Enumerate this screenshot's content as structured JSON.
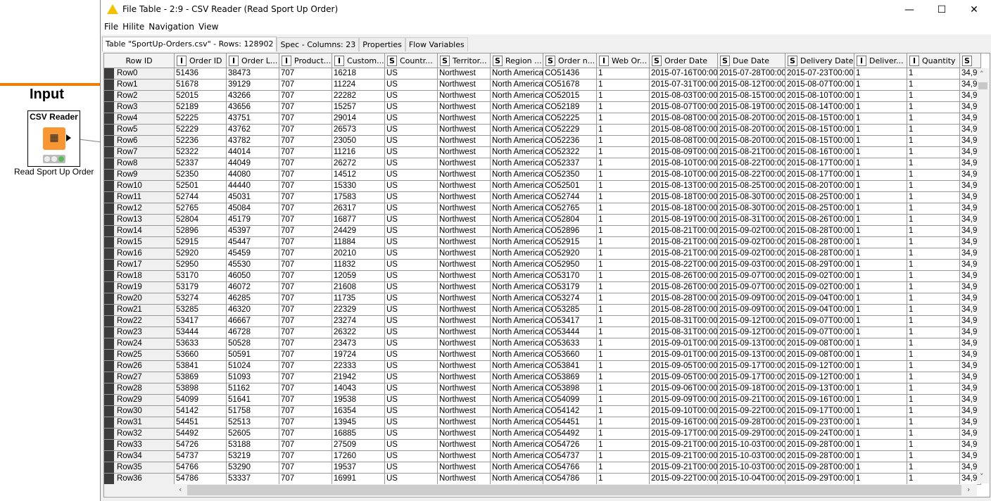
{
  "canvas": {
    "annotation_title": "Input",
    "node_name": "CSV Reader",
    "node_label": "Read Sport Up Order",
    "node_color": "#f79632",
    "annotation_color": "#f07d00"
  },
  "window": {
    "title": "File Table - 2:9 - CSV Reader (Read Sport Up Order)",
    "minimize": "—",
    "maximize": "☐",
    "close": "✕"
  },
  "menu": [
    "File",
    "Hilite",
    "Navigation",
    "View"
  ],
  "tabs": [
    {
      "label": "Table \"SportUp-Orders.csv\" - Rows: 128902",
      "active": true
    },
    {
      "label": "Spec - Columns: 23",
      "active": false
    },
    {
      "label": "Properties",
      "active": false
    },
    {
      "label": "Flow Variables",
      "active": false
    }
  ],
  "table": {
    "columns": [
      {
        "type": "",
        "label": "Row ID"
      },
      {
        "type": "I",
        "label": "Order ID"
      },
      {
        "type": "I",
        "label": "Order L..."
      },
      {
        "type": "I",
        "label": "Product..."
      },
      {
        "type": "I",
        "label": "Custom..."
      },
      {
        "type": "S",
        "label": "Countr..."
      },
      {
        "type": "S",
        "label": "Territor..."
      },
      {
        "type": "S",
        "label": "Region ..."
      },
      {
        "type": "S",
        "label": "Order n..."
      },
      {
        "type": "I",
        "label": "Web Or..."
      },
      {
        "type": "S",
        "label": "Order Date"
      },
      {
        "type": "S",
        "label": "Due Date"
      },
      {
        "type": "S",
        "label": "Delivery Date"
      },
      {
        "type": "I",
        "label": "Deliver..."
      },
      {
        "type": "I",
        "label": "Quantity"
      },
      {
        "type": "S",
        "label": ""
      }
    ],
    "rows": [
      [
        "Row0",
        "51436",
        "38473",
        "707",
        "16218",
        "US",
        "Northwest",
        "North America",
        "CO51436",
        "1",
        "2015-07-16T00:00",
        "2015-07-28T00:00",
        "2015-07-23T00:00",
        "1",
        "1",
        "34,9"
      ],
      [
        "Row1",
        "51678",
        "39129",
        "707",
        "11224",
        "US",
        "Northwest",
        "North America",
        "CO51678",
        "1",
        "2015-07-31T00:00",
        "2015-08-12T00:00",
        "2015-08-07T00:00",
        "1",
        "1",
        "34,9"
      ],
      [
        "Row2",
        "52015",
        "43266",
        "707",
        "22282",
        "US",
        "Northwest",
        "North America",
        "CO52015",
        "1",
        "2015-08-03T00:00",
        "2015-08-15T00:00",
        "2015-08-10T00:00",
        "1",
        "1",
        "34,9"
      ],
      [
        "Row3",
        "52189",
        "43656",
        "707",
        "15257",
        "US",
        "Northwest",
        "North America",
        "CO52189",
        "1",
        "2015-08-07T00:00",
        "2015-08-19T00:00",
        "2015-08-14T00:00",
        "1",
        "1",
        "34,9"
      ],
      [
        "Row4",
        "52225",
        "43751",
        "707",
        "29014",
        "US",
        "Northwest",
        "North America",
        "CO52225",
        "1",
        "2015-08-08T00:00",
        "2015-08-20T00:00",
        "2015-08-15T00:00",
        "1",
        "1",
        "34,9"
      ],
      [
        "Row5",
        "52229",
        "43762",
        "707",
        "26573",
        "US",
        "Northwest",
        "North America",
        "CO52229",
        "1",
        "2015-08-08T00:00",
        "2015-08-20T00:00",
        "2015-08-15T00:00",
        "1",
        "1",
        "34,9"
      ],
      [
        "Row6",
        "52236",
        "43782",
        "707",
        "23050",
        "US",
        "Northwest",
        "North America",
        "CO52236",
        "1",
        "2015-08-08T00:00",
        "2015-08-20T00:00",
        "2015-08-15T00:00",
        "1",
        "1",
        "34,9"
      ],
      [
        "Row7",
        "52322",
        "44014",
        "707",
        "11216",
        "US",
        "Northwest",
        "North America",
        "CO52322",
        "1",
        "2015-08-09T00:00",
        "2015-08-21T00:00",
        "2015-08-16T00:00",
        "1",
        "1",
        "34,9"
      ],
      [
        "Row8",
        "52337",
        "44049",
        "707",
        "26272",
        "US",
        "Northwest",
        "North America",
        "CO52337",
        "1",
        "2015-08-10T00:00",
        "2015-08-22T00:00",
        "2015-08-17T00:00",
        "1",
        "1",
        "34,9"
      ],
      [
        "Row9",
        "52350",
        "44080",
        "707",
        "14512",
        "US",
        "Northwest",
        "North America",
        "CO52350",
        "1",
        "2015-08-10T00:00",
        "2015-08-22T00:00",
        "2015-08-17T00:00",
        "1",
        "1",
        "34,9"
      ],
      [
        "Row10",
        "52501",
        "44440",
        "707",
        "15330",
        "US",
        "Northwest",
        "North America",
        "CO52501",
        "1",
        "2015-08-13T00:00",
        "2015-08-25T00:00",
        "2015-08-20T00:00",
        "1",
        "1",
        "34,9"
      ],
      [
        "Row11",
        "52744",
        "45031",
        "707",
        "17583",
        "US",
        "Northwest",
        "North America",
        "CO52744",
        "1",
        "2015-08-18T00:00",
        "2015-08-30T00:00",
        "2015-08-25T00:00",
        "1",
        "1",
        "34,9"
      ],
      [
        "Row12",
        "52765",
        "45084",
        "707",
        "26317",
        "US",
        "Northwest",
        "North America",
        "CO52765",
        "1",
        "2015-08-18T00:00",
        "2015-08-30T00:00",
        "2015-08-25T00:00",
        "1",
        "1",
        "34,9"
      ],
      [
        "Row13",
        "52804",
        "45179",
        "707",
        "16877",
        "US",
        "Northwest",
        "North America",
        "CO52804",
        "1",
        "2015-08-19T00:00",
        "2015-08-31T00:00",
        "2015-08-26T00:00",
        "1",
        "1",
        "34,9"
      ],
      [
        "Row14",
        "52896",
        "45397",
        "707",
        "24429",
        "US",
        "Northwest",
        "North America",
        "CO52896",
        "1",
        "2015-08-21T00:00",
        "2015-09-02T00:00",
        "2015-08-28T00:00",
        "1",
        "1",
        "34,9"
      ],
      [
        "Row15",
        "52915",
        "45447",
        "707",
        "11884",
        "US",
        "Northwest",
        "North America",
        "CO52915",
        "1",
        "2015-08-21T00:00",
        "2015-09-02T00:00",
        "2015-08-28T00:00",
        "1",
        "1",
        "34,9"
      ],
      [
        "Row16",
        "52920",
        "45459",
        "707",
        "20210",
        "US",
        "Northwest",
        "North America",
        "CO52920",
        "1",
        "2015-08-21T00:00",
        "2015-09-02T00:00",
        "2015-08-28T00:00",
        "1",
        "1",
        "34,9"
      ],
      [
        "Row17",
        "52950",
        "45530",
        "707",
        "11832",
        "US",
        "Northwest",
        "North America",
        "CO52950",
        "1",
        "2015-08-22T00:00",
        "2015-09-03T00:00",
        "2015-08-29T00:00",
        "1",
        "1",
        "34,9"
      ],
      [
        "Row18",
        "53170",
        "46050",
        "707",
        "12059",
        "US",
        "Northwest",
        "North America",
        "CO53170",
        "1",
        "2015-08-26T00:00",
        "2015-09-07T00:00",
        "2015-09-02T00:00",
        "1",
        "1",
        "34,9"
      ],
      [
        "Row19",
        "53179",
        "46072",
        "707",
        "21608",
        "US",
        "Northwest",
        "North America",
        "CO53179",
        "1",
        "2015-08-26T00:00",
        "2015-09-07T00:00",
        "2015-09-02T00:00",
        "1",
        "1",
        "34,9"
      ],
      [
        "Row20",
        "53274",
        "46285",
        "707",
        "11735",
        "US",
        "Northwest",
        "North America",
        "CO53274",
        "1",
        "2015-08-28T00:00",
        "2015-09-09T00:00",
        "2015-09-04T00:00",
        "1",
        "1",
        "34,9"
      ],
      [
        "Row21",
        "53285",
        "46320",
        "707",
        "22329",
        "US",
        "Northwest",
        "North America",
        "CO53285",
        "1",
        "2015-08-28T00:00",
        "2015-09-09T00:00",
        "2015-09-04T00:00",
        "1",
        "1",
        "34,9"
      ],
      [
        "Row22",
        "53417",
        "46667",
        "707",
        "23274",
        "US",
        "Northwest",
        "North America",
        "CO53417",
        "1",
        "2015-08-31T00:00",
        "2015-09-12T00:00",
        "2015-09-07T00:00",
        "1",
        "1",
        "34,9"
      ],
      [
        "Row23",
        "53444",
        "46728",
        "707",
        "26322",
        "US",
        "Northwest",
        "North America",
        "CO53444",
        "1",
        "2015-08-31T00:00",
        "2015-09-12T00:00",
        "2015-09-07T00:00",
        "1",
        "1",
        "34,9"
      ],
      [
        "Row24",
        "53633",
        "50528",
        "707",
        "23473",
        "US",
        "Northwest",
        "North America",
        "CO53633",
        "1",
        "2015-09-01T00:00",
        "2015-09-13T00:00",
        "2015-09-08T00:00",
        "1",
        "1",
        "34,9"
      ],
      [
        "Row25",
        "53660",
        "50591",
        "707",
        "19724",
        "US",
        "Northwest",
        "North America",
        "CO53660",
        "1",
        "2015-09-01T00:00",
        "2015-09-13T00:00",
        "2015-09-08T00:00",
        "1",
        "1",
        "34,9"
      ],
      [
        "Row26",
        "53841",
        "51024",
        "707",
        "22333",
        "US",
        "Northwest",
        "North America",
        "CO53841",
        "1",
        "2015-09-05T00:00",
        "2015-09-17T00:00",
        "2015-09-12T00:00",
        "1",
        "1",
        "34,9"
      ],
      [
        "Row27",
        "53869",
        "51093",
        "707",
        "21942",
        "US",
        "Northwest",
        "North America",
        "CO53869",
        "1",
        "2015-09-05T00:00",
        "2015-09-17T00:00",
        "2015-09-12T00:00",
        "1",
        "1",
        "34,9"
      ],
      [
        "Row28",
        "53898",
        "51162",
        "707",
        "14043",
        "US",
        "Northwest",
        "North America",
        "CO53898",
        "1",
        "2015-09-06T00:00",
        "2015-09-18T00:00",
        "2015-09-13T00:00",
        "1",
        "1",
        "34,9"
      ],
      [
        "Row29",
        "54099",
        "51641",
        "707",
        "19538",
        "US",
        "Northwest",
        "North America",
        "CO54099",
        "1",
        "2015-09-09T00:00",
        "2015-09-21T00:00",
        "2015-09-16T00:00",
        "1",
        "1",
        "34,9"
      ],
      [
        "Row30",
        "54142",
        "51758",
        "707",
        "16354",
        "US",
        "Northwest",
        "North America",
        "CO54142",
        "1",
        "2015-09-10T00:00",
        "2015-09-22T00:00",
        "2015-09-17T00:00",
        "1",
        "1",
        "34,9"
      ],
      [
        "Row31",
        "54451",
        "52513",
        "707",
        "13945",
        "US",
        "Northwest",
        "North America",
        "CO54451",
        "1",
        "2015-09-16T00:00",
        "2015-09-28T00:00",
        "2015-09-23T00:00",
        "1",
        "1",
        "34,9"
      ],
      [
        "Row32",
        "54492",
        "52605",
        "707",
        "16885",
        "US",
        "Northwest",
        "North America",
        "CO54492",
        "1",
        "2015-09-17T00:00",
        "2015-09-29T00:00",
        "2015-09-24T00:00",
        "1",
        "1",
        "34,9"
      ],
      [
        "Row33",
        "54726",
        "53188",
        "707",
        "27509",
        "US",
        "Northwest",
        "North America",
        "CO54726",
        "1",
        "2015-09-21T00:00",
        "2015-10-03T00:00",
        "2015-09-28T00:00",
        "1",
        "1",
        "34,9"
      ],
      [
        "Row34",
        "54737",
        "53219",
        "707",
        "17260",
        "US",
        "Northwest",
        "North America",
        "CO54737",
        "1",
        "2015-09-21T00:00",
        "2015-10-03T00:00",
        "2015-09-28T00:00",
        "1",
        "1",
        "34,9"
      ],
      [
        "Row35",
        "54766",
        "53290",
        "707",
        "19537",
        "US",
        "Northwest",
        "North America",
        "CO54766",
        "1",
        "2015-09-21T00:00",
        "2015-10-03T00:00",
        "2015-09-28T00:00",
        "1",
        "1",
        "34,9"
      ],
      [
        "Row36",
        "54786",
        "53337",
        "707",
        "16991",
        "US",
        "Northwest",
        "North America",
        "CO54786",
        "1",
        "2015-09-22T00:00",
        "2015-10-04T00:00",
        "2015-09-29T00:00",
        "1",
        "1",
        "34,9"
      ]
    ]
  }
}
